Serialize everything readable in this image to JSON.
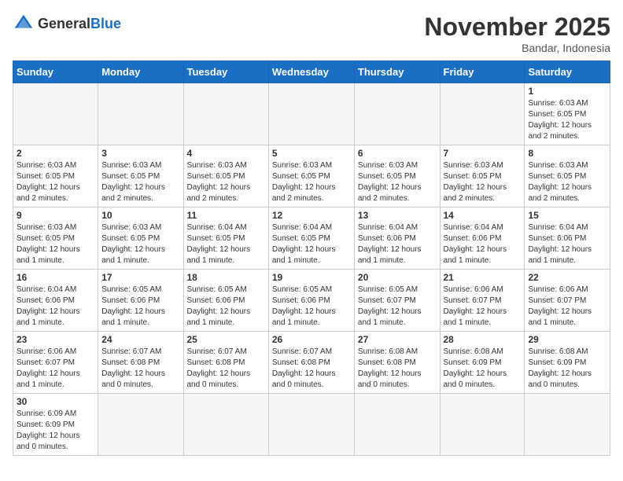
{
  "logo": {
    "text_general": "General",
    "text_blue": "Blue"
  },
  "header": {
    "month_title": "November 2025",
    "subtitle": "Bandar, Indonesia"
  },
  "weekdays": [
    "Sunday",
    "Monday",
    "Tuesday",
    "Wednesday",
    "Thursday",
    "Friday",
    "Saturday"
  ],
  "weeks": [
    [
      {
        "day": "",
        "info": ""
      },
      {
        "day": "",
        "info": ""
      },
      {
        "day": "",
        "info": ""
      },
      {
        "day": "",
        "info": ""
      },
      {
        "day": "",
        "info": ""
      },
      {
        "day": "",
        "info": ""
      },
      {
        "day": "1",
        "info": "Sunrise: 6:03 AM\nSunset: 6:05 PM\nDaylight: 12 hours and 2 minutes."
      }
    ],
    [
      {
        "day": "2",
        "info": "Sunrise: 6:03 AM\nSunset: 6:05 PM\nDaylight: 12 hours and 2 minutes."
      },
      {
        "day": "3",
        "info": "Sunrise: 6:03 AM\nSunset: 6:05 PM\nDaylight: 12 hours and 2 minutes."
      },
      {
        "day": "4",
        "info": "Sunrise: 6:03 AM\nSunset: 6:05 PM\nDaylight: 12 hours and 2 minutes."
      },
      {
        "day": "5",
        "info": "Sunrise: 6:03 AM\nSunset: 6:05 PM\nDaylight: 12 hours and 2 minutes."
      },
      {
        "day": "6",
        "info": "Sunrise: 6:03 AM\nSunset: 6:05 PM\nDaylight: 12 hours and 2 minutes."
      },
      {
        "day": "7",
        "info": "Sunrise: 6:03 AM\nSunset: 6:05 PM\nDaylight: 12 hours and 2 minutes."
      },
      {
        "day": "8",
        "info": "Sunrise: 6:03 AM\nSunset: 6:05 PM\nDaylight: 12 hours and 2 minutes."
      }
    ],
    [
      {
        "day": "9",
        "info": "Sunrise: 6:03 AM\nSunset: 6:05 PM\nDaylight: 12 hours and 1 minute."
      },
      {
        "day": "10",
        "info": "Sunrise: 6:03 AM\nSunset: 6:05 PM\nDaylight: 12 hours and 1 minute."
      },
      {
        "day": "11",
        "info": "Sunrise: 6:04 AM\nSunset: 6:05 PM\nDaylight: 12 hours and 1 minute."
      },
      {
        "day": "12",
        "info": "Sunrise: 6:04 AM\nSunset: 6:05 PM\nDaylight: 12 hours and 1 minute."
      },
      {
        "day": "13",
        "info": "Sunrise: 6:04 AM\nSunset: 6:06 PM\nDaylight: 12 hours and 1 minute."
      },
      {
        "day": "14",
        "info": "Sunrise: 6:04 AM\nSunset: 6:06 PM\nDaylight: 12 hours and 1 minute."
      },
      {
        "day": "15",
        "info": "Sunrise: 6:04 AM\nSunset: 6:06 PM\nDaylight: 12 hours and 1 minute."
      }
    ],
    [
      {
        "day": "16",
        "info": "Sunrise: 6:04 AM\nSunset: 6:06 PM\nDaylight: 12 hours and 1 minute."
      },
      {
        "day": "17",
        "info": "Sunrise: 6:05 AM\nSunset: 6:06 PM\nDaylight: 12 hours and 1 minute."
      },
      {
        "day": "18",
        "info": "Sunrise: 6:05 AM\nSunset: 6:06 PM\nDaylight: 12 hours and 1 minute."
      },
      {
        "day": "19",
        "info": "Sunrise: 6:05 AM\nSunset: 6:06 PM\nDaylight: 12 hours and 1 minute."
      },
      {
        "day": "20",
        "info": "Sunrise: 6:05 AM\nSunset: 6:07 PM\nDaylight: 12 hours and 1 minute."
      },
      {
        "day": "21",
        "info": "Sunrise: 6:06 AM\nSunset: 6:07 PM\nDaylight: 12 hours and 1 minute."
      },
      {
        "day": "22",
        "info": "Sunrise: 6:06 AM\nSunset: 6:07 PM\nDaylight: 12 hours and 1 minute."
      }
    ],
    [
      {
        "day": "23",
        "info": "Sunrise: 6:06 AM\nSunset: 6:07 PM\nDaylight: 12 hours and 1 minute."
      },
      {
        "day": "24",
        "info": "Sunrise: 6:07 AM\nSunset: 6:08 PM\nDaylight: 12 hours and 0 minutes."
      },
      {
        "day": "25",
        "info": "Sunrise: 6:07 AM\nSunset: 6:08 PM\nDaylight: 12 hours and 0 minutes."
      },
      {
        "day": "26",
        "info": "Sunrise: 6:07 AM\nSunset: 6:08 PM\nDaylight: 12 hours and 0 minutes."
      },
      {
        "day": "27",
        "info": "Sunrise: 6:08 AM\nSunset: 6:08 PM\nDaylight: 12 hours and 0 minutes."
      },
      {
        "day": "28",
        "info": "Sunrise: 6:08 AM\nSunset: 6:09 PM\nDaylight: 12 hours and 0 minutes."
      },
      {
        "day": "29",
        "info": "Sunrise: 6:08 AM\nSunset: 6:09 PM\nDaylight: 12 hours and 0 minutes."
      }
    ],
    [
      {
        "day": "30",
        "info": "Sunrise: 6:09 AM\nSunset: 6:09 PM\nDaylight: 12 hours and 0 minutes."
      },
      {
        "day": "",
        "info": ""
      },
      {
        "day": "",
        "info": ""
      },
      {
        "day": "",
        "info": ""
      },
      {
        "day": "",
        "info": ""
      },
      {
        "day": "",
        "info": ""
      },
      {
        "day": "",
        "info": ""
      }
    ]
  ]
}
